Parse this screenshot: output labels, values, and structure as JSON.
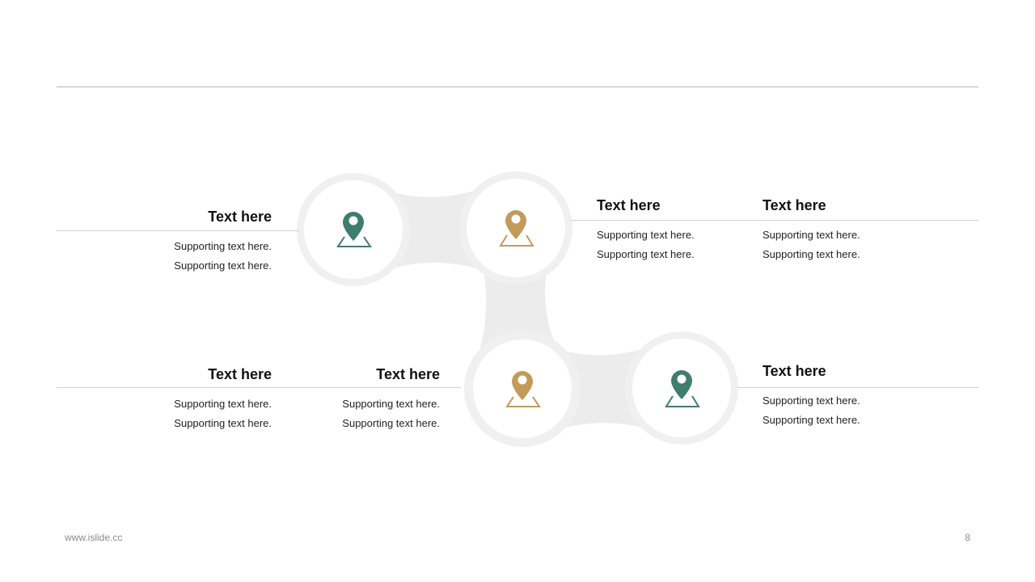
{
  "colors": {
    "teal": "#3f7d6e",
    "gold": "#c39a5a",
    "ring": "#f0f0f0",
    "connector": "#ececec"
  },
  "nodes": [
    {
      "icon": "map-pin-icon",
      "color": "teal"
    },
    {
      "icon": "map-pin-icon",
      "color": "gold"
    },
    {
      "icon": "map-pin-icon",
      "color": "gold"
    },
    {
      "icon": "map-pin-icon",
      "color": "teal"
    }
  ],
  "items": [
    {
      "title": "Text here",
      "line1": "Supporting  text here.",
      "line2": "Supporting  text here."
    },
    {
      "title": "Text here",
      "line1": "Supporting  text here.",
      "line2": "Supporting  text here."
    },
    {
      "title": "Text here",
      "line1": "Supporting  text here.",
      "line2": "Supporting  text here."
    },
    {
      "title": "Text here",
      "line1": "Supporting  text here.",
      "line2": "Supporting  text here."
    },
    {
      "title": "Text here",
      "line1": "Supporting  text here.",
      "line2": "Supporting  text here."
    },
    {
      "title": "Text here",
      "line1": "Supporting  text here.",
      "line2": "Supporting  text here."
    }
  ],
  "footer": {
    "url": "www.islide.cc",
    "page": "8"
  }
}
